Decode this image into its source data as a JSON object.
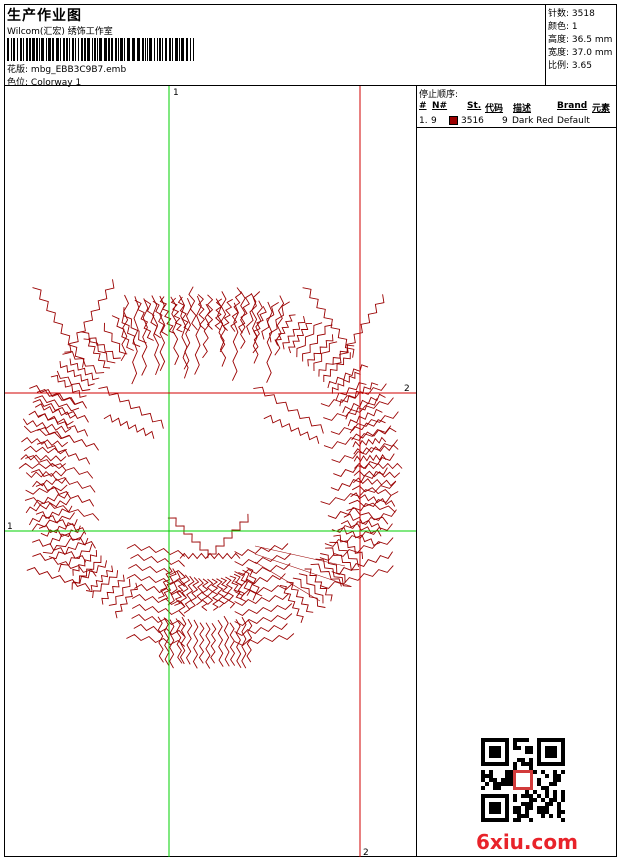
{
  "header": {
    "title": "生产作业图",
    "subtitle": "Wilcom(汇宏) 绣饰工作室",
    "design_label": "花版:",
    "design_value": "mbg_EBB3C9B7.emb",
    "colorway_label": "色位:",
    "colorway_value": "Colorway 1"
  },
  "stats": [
    {
      "label": "针数:",
      "value": "3518"
    },
    {
      "label": "颜色:",
      "value": "1"
    },
    {
      "label": "高度:",
      "value": "36.5 mm"
    },
    {
      "label": "宽度:",
      "value": "37.0 mm"
    },
    {
      "label": "比例:",
      "value": "3.65"
    }
  ],
  "guides": {
    "v1": "1",
    "h2": "2",
    "v2": "2",
    "h1": "1"
  },
  "colors": {
    "thread": "#9a0000",
    "guide_green": "#00d000",
    "guide_red": "#d00000",
    "watermark": "#e8232a"
  },
  "stop_sequence": {
    "title": "停止顺序:",
    "headers": [
      "#",
      "N#",
      "St.",
      "代码",
      "描述",
      "Brand",
      "元素"
    ],
    "rows": [
      {
        "index": "1.",
        "n": "9",
        "stitches": "3516",
        "code": "9",
        "description": "Dark Red",
        "brand": "Default"
      }
    ]
  },
  "watermark": {
    "text": "6xiu.com"
  }
}
